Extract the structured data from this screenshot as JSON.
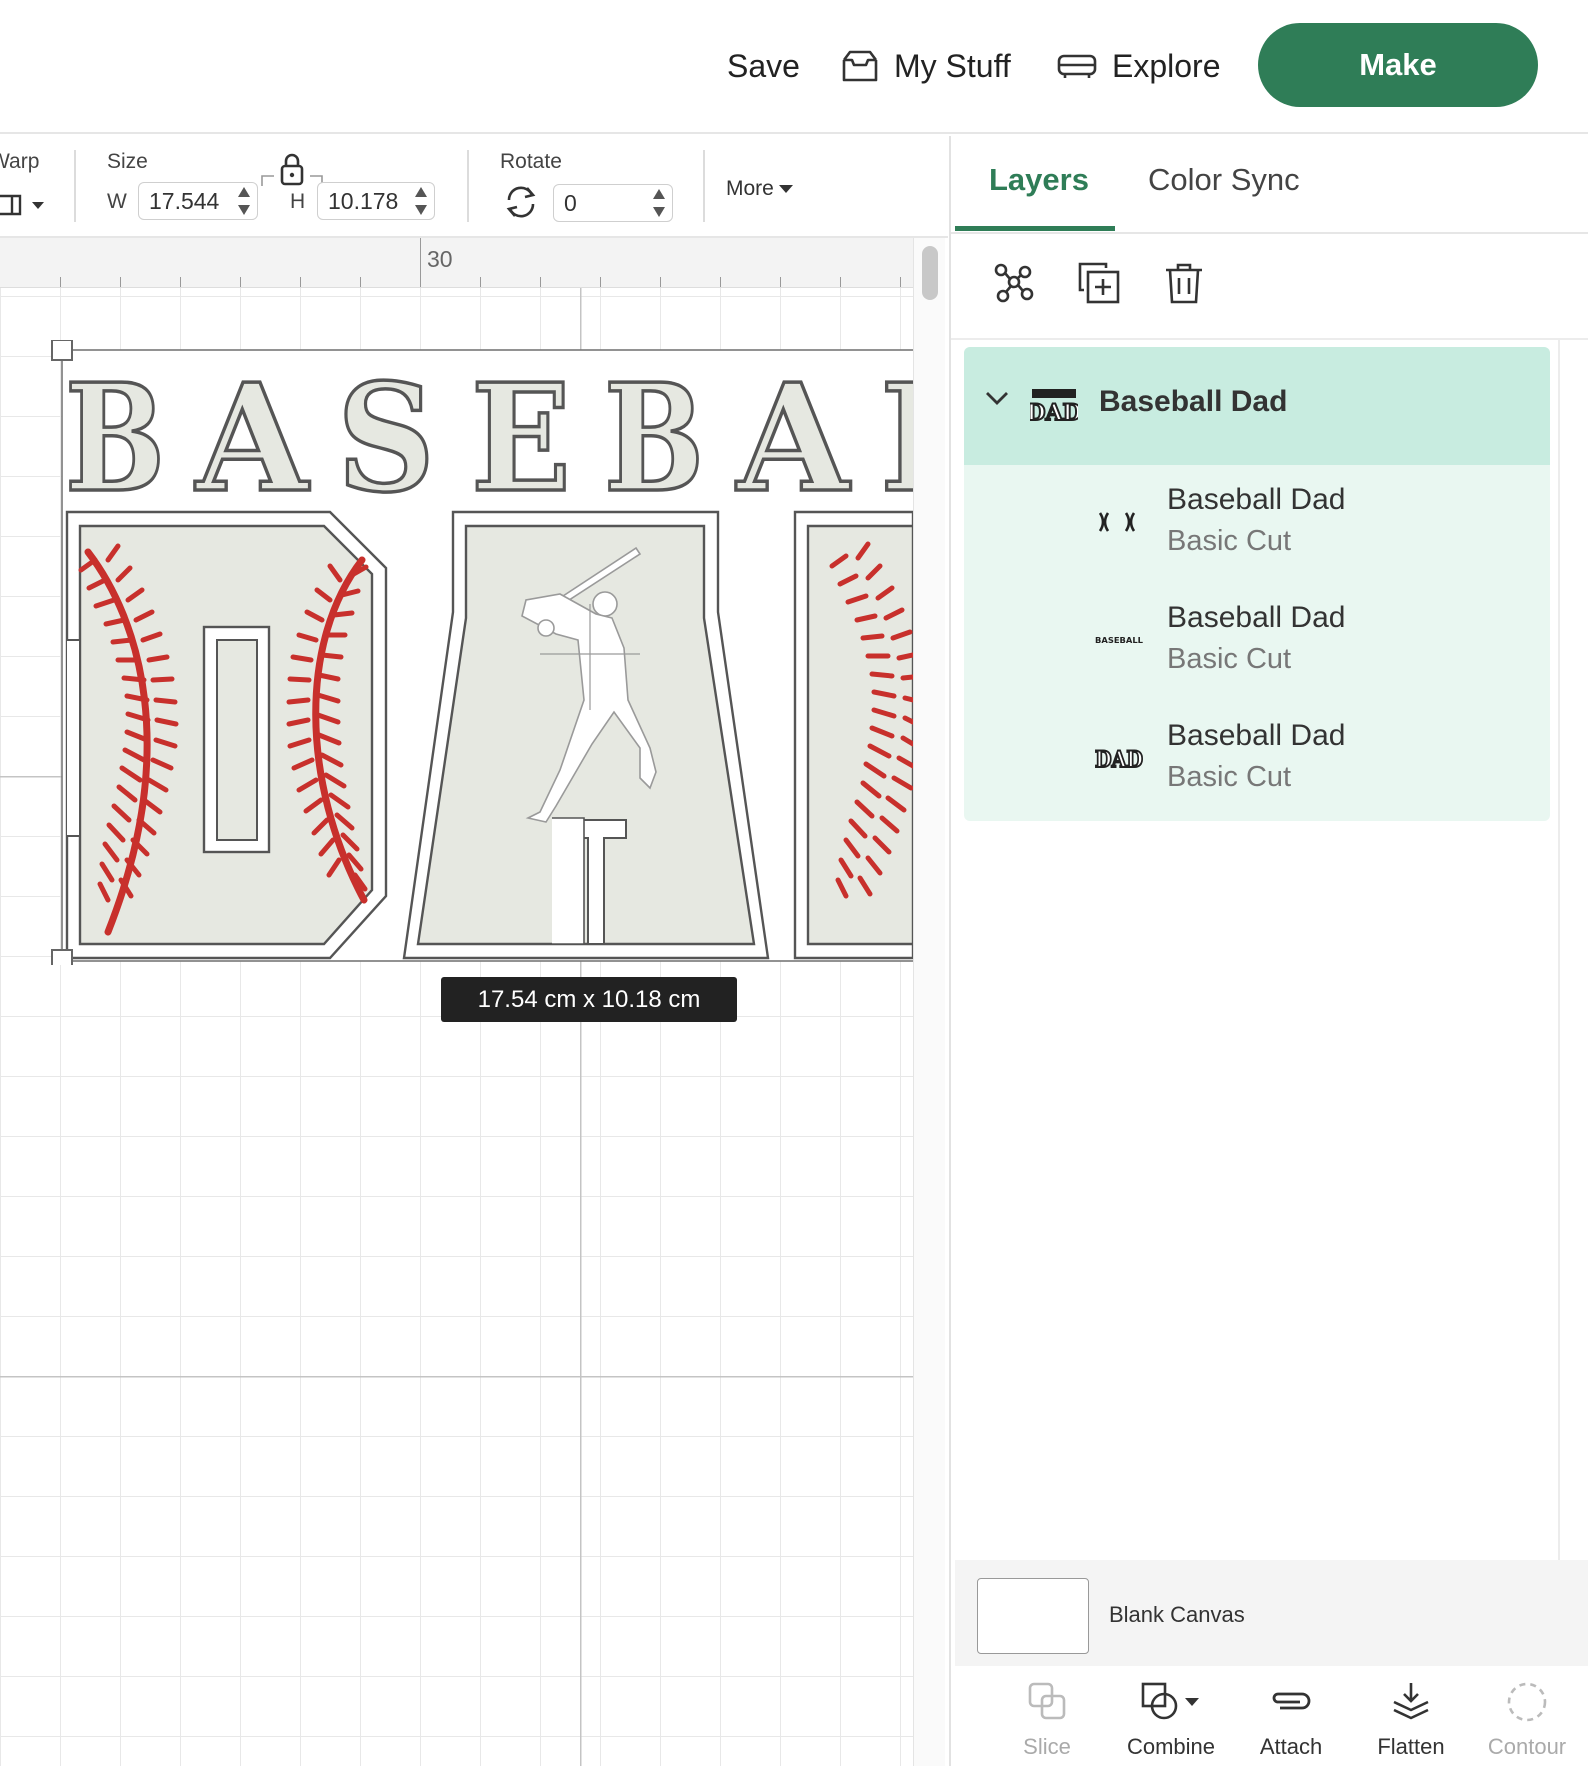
{
  "topbar": {
    "save_label": "Save",
    "mystuff_label": "My Stuff",
    "explore_label": "Explore",
    "make_label": "Make",
    "accent_color": "#2f7d57"
  },
  "toolbar": {
    "warp_label": "Warp",
    "size_label": "Size",
    "w_label": "W",
    "w_value": "17.544",
    "h_label": "H",
    "h_value": "10.178",
    "rotate_label": "Rotate",
    "rotate_value": "0",
    "more_label": "More"
  },
  "canvas": {
    "ruler_label": "30",
    "design_top_text": "BASEBALL",
    "design_bottom_text": "DAD",
    "size_tooltip": "17.54  cm x 10.18  cm",
    "stitch_color": "#c8302c",
    "letter_fill": "#e6e8e1"
  },
  "panel": {
    "tab_layers": "Layers",
    "tab_colorsync": "Color Sync",
    "group": {
      "name": "Baseball Dad",
      "thumb_text": "DAD"
    },
    "layers": [
      {
        "name": "Baseball Dad",
        "type": "Basic Cut",
        "thumb": "stitches"
      },
      {
        "name": "Baseball Dad",
        "type": "Basic Cut",
        "thumb": "BASEBALL"
      },
      {
        "name": "Baseball Dad",
        "type": "Basic Cut",
        "thumb": "DAD"
      }
    ],
    "blank_canvas_label": "Blank Canvas",
    "actions": [
      {
        "label": "Slice",
        "enabled": false
      },
      {
        "label": "Combine",
        "enabled": true
      },
      {
        "label": "Attach",
        "enabled": true
      },
      {
        "label": "Flatten",
        "enabled": true
      },
      {
        "label": "Contour",
        "enabled": false
      }
    ]
  }
}
